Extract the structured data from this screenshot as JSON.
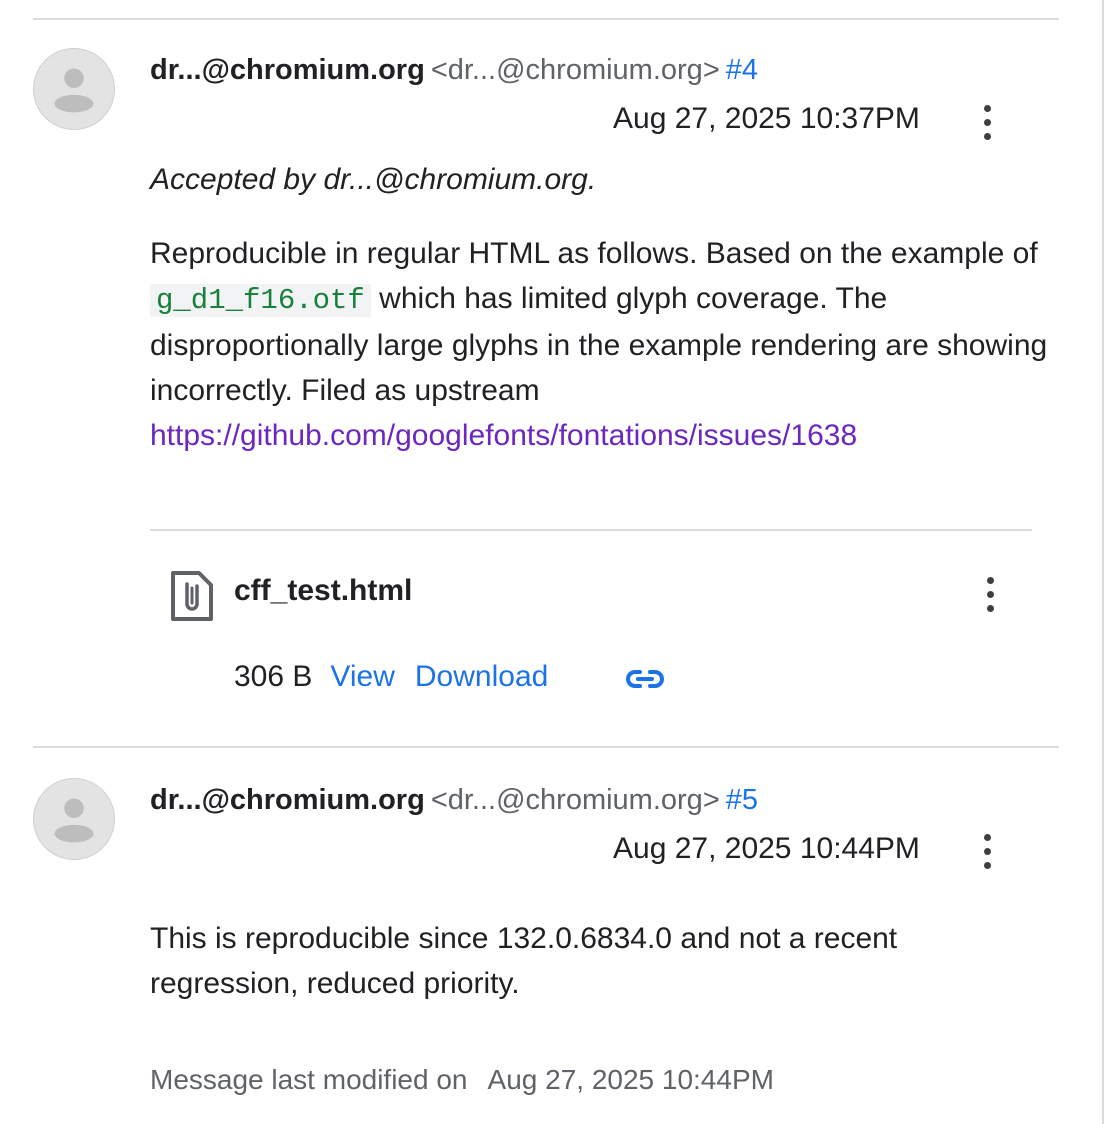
{
  "colors": {
    "link_blue": "#1a73e8",
    "link_purple": "#6b27c1",
    "code_green": "#188038",
    "divider": "#dadce0"
  },
  "comment4": {
    "author": "dr...@chromium.org",
    "email": "<dr...@chromium.org>",
    "number": "#4",
    "timestamp": "Aug 27, 2025 10:37PM",
    "accepted": "Accepted by dr...@chromium.org.",
    "body_part1": "Reproducible in regular HTML as follows. Based on the example of ",
    "code": "g_d1_f16.otf",
    "body_part2": " which has limited glyph coverage. The disproportionally large glyphs in the example rendering are showing incorrectly. Filed as upstream ",
    "link": "https://github.com/googlefonts/fontations/issues/1638",
    "attachment": {
      "icon": "attachment-file-icon",
      "name": "cff_test.html",
      "size": "306 B",
      "view_label": "View",
      "download_label": "Download",
      "copy_link_icon": "link-icon"
    }
  },
  "comment5": {
    "author": "dr...@chromium.org",
    "email": "<dr...@chromium.org>",
    "number": "#5",
    "timestamp": "Aug 27, 2025 10:44PM",
    "body": "This is reproducible since 132.0.6834.0 and not a recent regression, reduced priority."
  },
  "footer": {
    "label": "Message last modified on",
    "date": "Aug 27, 2025 10:44PM"
  }
}
